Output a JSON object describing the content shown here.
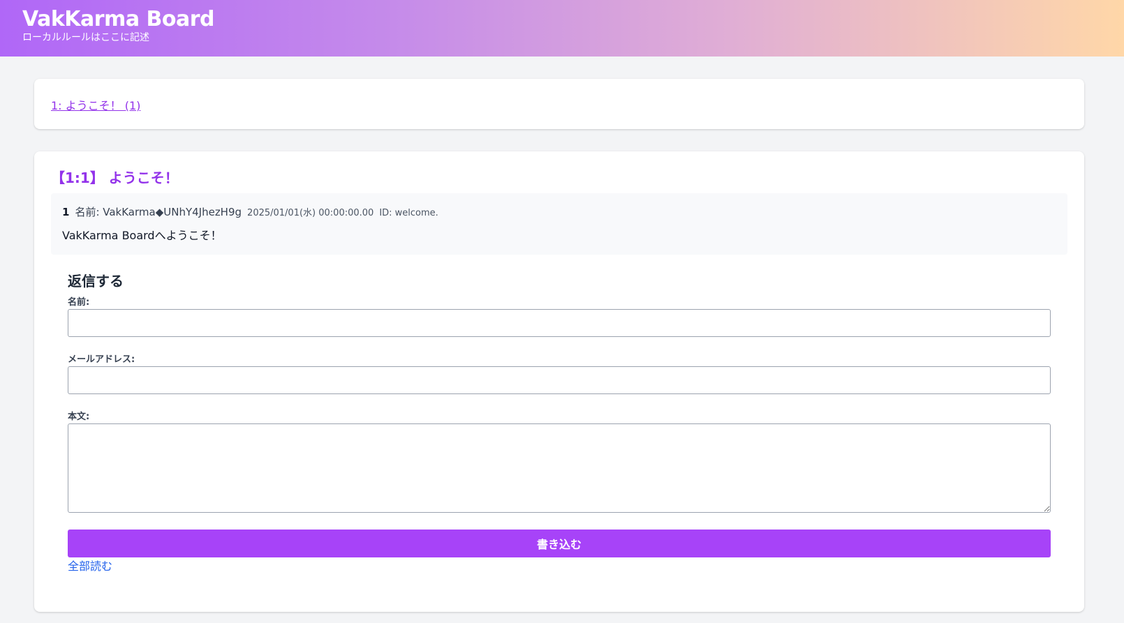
{
  "header": {
    "title": "VakKarma Board",
    "subtitle": "ローカルルールはここに記述"
  },
  "thread_list": {
    "items": [
      {
        "label": "1: ようこそ！ (1)"
      }
    ]
  },
  "thread": {
    "title": "【1:1】 ようこそ！",
    "posts": [
      {
        "number": "1",
        "name": "名前: VakKarma◆UNhY4JhezH9g",
        "date": "2025/01/01(水) 00:00:00.00",
        "id": "ID: welcome.",
        "body": "VakKarma Boardへようこそ！"
      }
    ]
  },
  "reply_form": {
    "heading": "返信する",
    "name_label": "名前:",
    "name_value": "",
    "email_label": "メールアドレス:",
    "email_value": "",
    "body_label": "本文:",
    "body_value": "",
    "submit_label": "書き込む",
    "read_all_label": "全部読む"
  },
  "colors": {
    "accent": "#9333ea",
    "button": "#a743f8",
    "link": "#2563eb",
    "header_gradient_start": "#b067f7",
    "header_gradient_end": "#ffd7a8"
  }
}
